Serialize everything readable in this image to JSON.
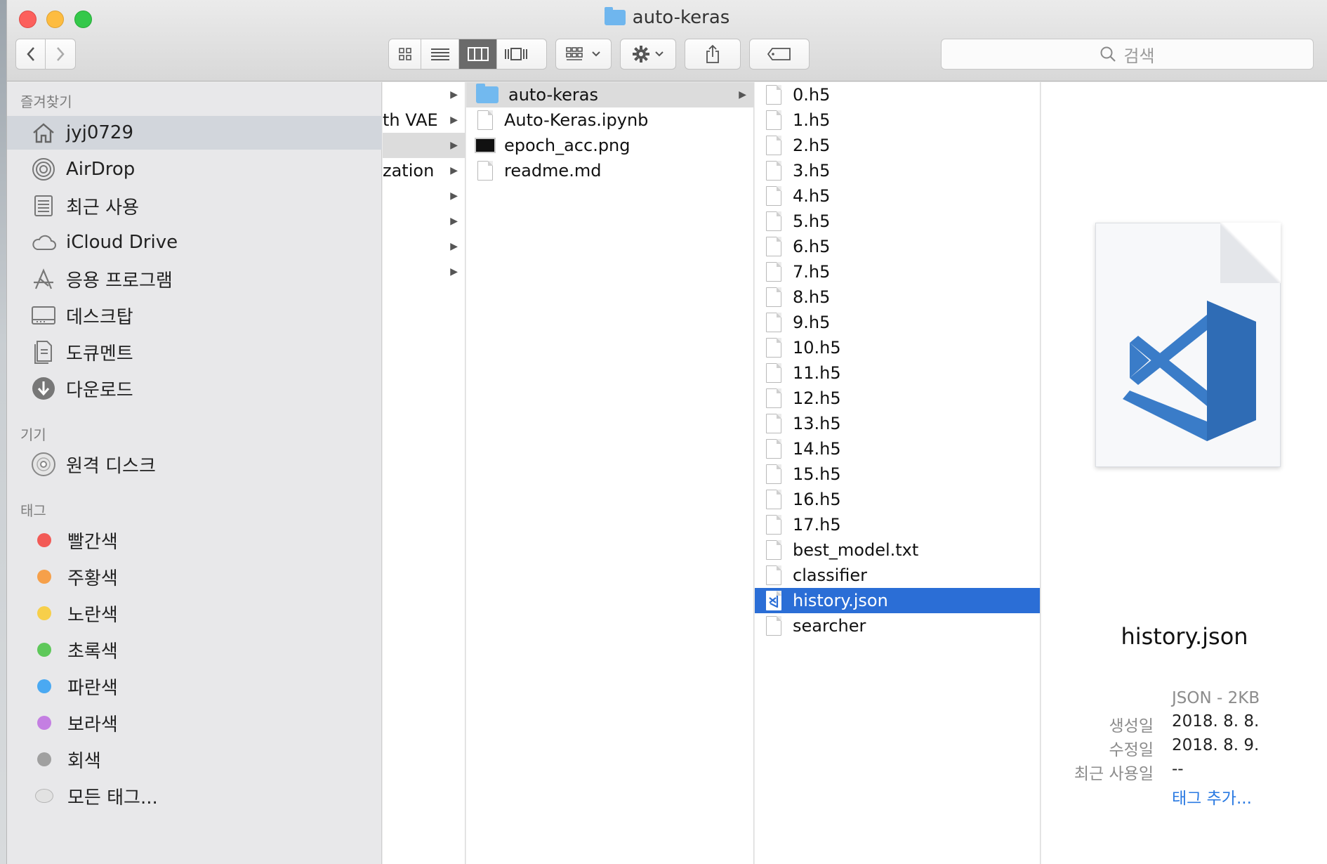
{
  "window": {
    "title": "auto-keras"
  },
  "toolbar": {
    "search_placeholder": "검색",
    "back": "‹",
    "forward": "›"
  },
  "sidebar": {
    "favorites_header": "즐겨찾기",
    "favorites": [
      {
        "label": "jyj0729",
        "icon": "home-icon",
        "selected": true
      },
      {
        "label": "AirDrop",
        "icon": "airdrop-icon"
      },
      {
        "label": "최근 사용",
        "icon": "recents-icon"
      },
      {
        "label": "iCloud Drive",
        "icon": "cloud-icon"
      },
      {
        "label": "응용 프로그램",
        "icon": "applications-icon"
      },
      {
        "label": "데스크탑",
        "icon": "desktop-icon"
      },
      {
        "label": "도큐멘트",
        "icon": "documents-icon"
      },
      {
        "label": "다운로드",
        "icon": "downloads-icon"
      }
    ],
    "devices_header": "기기",
    "devices": [
      {
        "label": "원격 디스크",
        "icon": "disc-icon"
      }
    ],
    "tags_header": "태그",
    "tags": [
      {
        "label": "빨간색",
        "color": "#f25a56"
      },
      {
        "label": "주황색",
        "color": "#f6a04a"
      },
      {
        "label": "노란색",
        "color": "#f7cf4a"
      },
      {
        "label": "초록색",
        "color": "#5ec85a"
      },
      {
        "label": "파란색",
        "color": "#4aa9f2"
      },
      {
        "label": "보라색",
        "color": "#c47fe2"
      },
      {
        "label": "회색",
        "color": "#a0a0a0"
      },
      {
        "label": "모든 태그...",
        "color": "#dcdcdc"
      }
    ]
  },
  "column1": {
    "items": [
      {
        "label": ""
      },
      {
        "label": "th VAE"
      },
      {
        "label": ""
      },
      {
        "label": "zation"
      },
      {
        "label": ""
      },
      {
        "label": ""
      },
      {
        "label": ""
      },
      {
        "label": ""
      }
    ]
  },
  "column2": {
    "items": [
      {
        "label": "auto-keras",
        "type": "folder",
        "selected": true
      },
      {
        "label": "Auto-Keras.ipynb",
        "type": "file"
      },
      {
        "label": "epoch_acc.png",
        "type": "image"
      },
      {
        "label": "readme.md",
        "type": "text"
      }
    ]
  },
  "column3": {
    "items": [
      "0.h5",
      "1.h5",
      "2.h5",
      "3.h5",
      "4.h5",
      "5.h5",
      "6.h5",
      "7.h5",
      "8.h5",
      "9.h5",
      "10.h5",
      "11.h5",
      "12.h5",
      "13.h5",
      "14.h5",
      "15.h5",
      "16.h5",
      "17.h5",
      "best_model.txt",
      "classifier",
      "history.json",
      "searcher"
    ],
    "selected": "history.json"
  },
  "preview": {
    "filename": "history.json",
    "kind": "JSON - 2KB",
    "created_label": "생성일",
    "created": "2018. 8. 8.",
    "modified_label": "수정일",
    "modified": "2018. 8. 9.",
    "last_used_label": "최근 사용일",
    "last_used": "--",
    "add_tags": "태그 추가..."
  }
}
